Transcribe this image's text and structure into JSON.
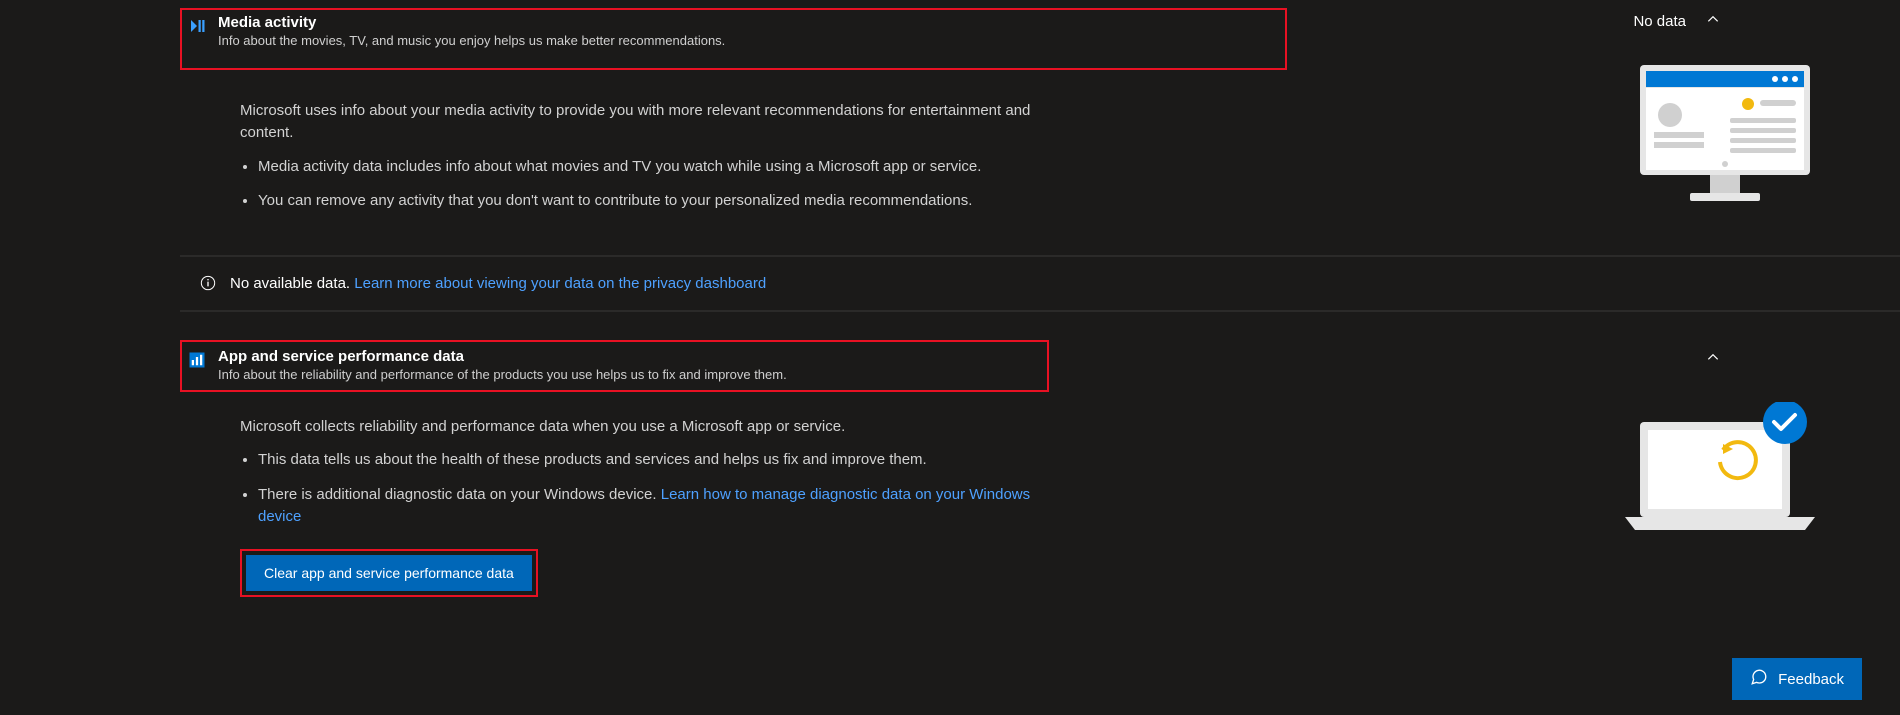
{
  "media": {
    "title": "Media activity",
    "desc": "Info about the movies, TV, and music you enjoy helps us make better recommendations.",
    "status": "No data",
    "intro": "Microsoft uses info about your media activity to provide you with more relevant recommendations for entertainment and content.",
    "bullet1": "Media activity data includes info about what movies and TV you watch while using a Microsoft app or service.",
    "bullet2": "You can remove any activity that you don't want to contribute to your personalized media recommendations."
  },
  "info_bar": {
    "no_data": "No available data.",
    "learn_more": "Learn more about viewing your data on the privacy dashboard"
  },
  "perf": {
    "title": "App and service performance data",
    "desc": "Info about the reliability and performance of the products you use helps us to fix and improve them.",
    "intro": "Microsoft collects reliability and performance data when you use a Microsoft app or service.",
    "bullet1": "This data tells us about the health of these products and services and helps us fix and improve them.",
    "bullet2a": "There is additional diagnostic data on your Windows device. ",
    "bullet2_link": "Learn how to manage diagnostic data on your Windows device",
    "clear_btn": "Clear app and service performance data"
  },
  "feedback": {
    "label": "Feedback"
  }
}
